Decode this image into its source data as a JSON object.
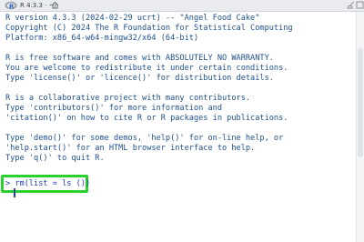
{
  "window": {
    "title": "R 4.3.3 · ~/",
    "icon_names": [
      "r-logo-icon",
      "home-icon",
      "broom-icon",
      "collapse-icon"
    ]
  },
  "console": {
    "lines": [
      "R version 4.3.3 (2024-02-29 ucrt) -- \"Angel Food Cake\"",
      "Copyright (C) 2024 The R Foundation for Statistical Computing",
      "Platform: x86_64-w64-mingw32/x64 (64-bit)",
      "",
      "R is free software and comes with ABSOLUTELY NO WARRANTY.",
      "You are welcome to redistribute it under certain conditions.",
      "Type 'license()' or 'licence()' for distribution details.",
      "",
      "R is a collaborative project with many contributors.",
      "Type 'contributors()' for more information and",
      "'citation()' on how to cite R or R packages in publications.",
      "",
      "Type 'demo()' for some demos, 'help()' for on-line help, or",
      "'help.start()' for an HTML browser interface to help.",
      "Type 'q()' to quit R."
    ],
    "prompt": "> rm(list = ls ())"
  },
  "colors": {
    "text": "#1f4f8a",
    "prompt": "#1a3fb0",
    "highlight": "#2ad12c"
  }
}
